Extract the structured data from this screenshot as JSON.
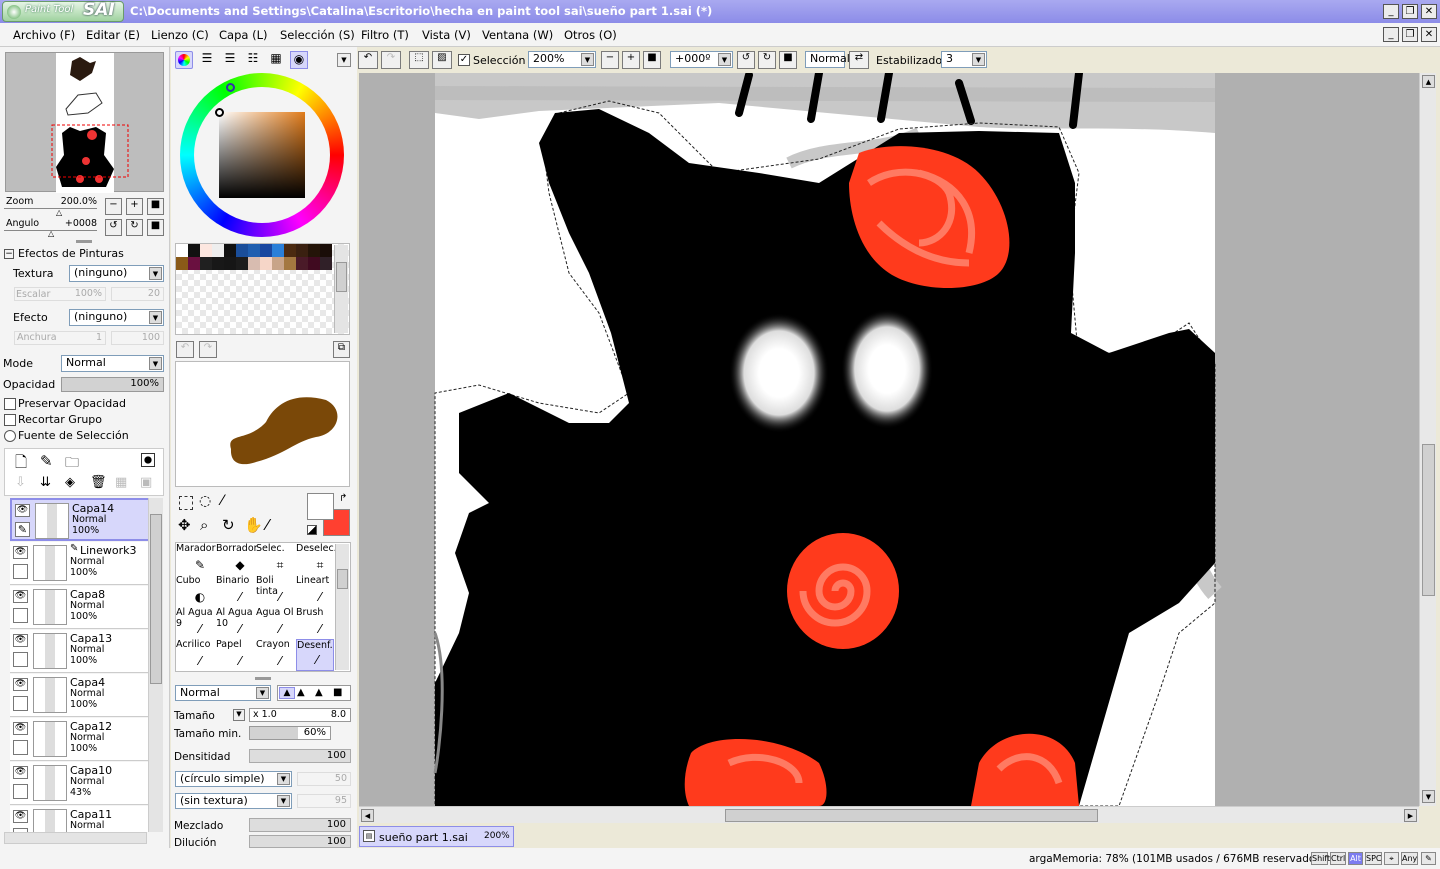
{
  "app": {
    "title": "C:\\Documents and Settings\\Catalina\\Escritorio\\hecha en paint tool sai\\sueño part 1.sai (*)",
    "logo_small": "Paint Tool",
    "logo_big": "SAI"
  },
  "menu": [
    "Archivo (F)",
    "Editar (E)",
    "Lienzo (C)",
    "Capa (L)",
    "Selección (S)",
    "Filtro (T)",
    "Vista (V)",
    "Ventana (W)",
    "Otros (O)"
  ],
  "toolbar": {
    "selection_label": "Selección",
    "zoom": "200%",
    "angle": "+000º",
    "blend": "Normal",
    "stabilizer_label": "Estabilizador",
    "stabilizer": "3"
  },
  "navigator": {
    "zoom_label": "Zoom",
    "zoom_value": "200.0%",
    "angle_label": "Angulo",
    "angle_value": "+0008"
  },
  "effects": {
    "title": "Efectos de Pinturas",
    "texture_label": "Textura",
    "texture_value": "(ninguno)",
    "scale_label": "Escalar",
    "scale_value": "100%",
    "scale_num": "20",
    "effect_label": "Efecto",
    "effect_value": "(ninguno)",
    "width_label": "Anchura",
    "width_value": "1",
    "width_num": "100"
  },
  "layer_props": {
    "mode_label": "Mode",
    "mode_value": "Normal",
    "opacity_label": "Opacidad",
    "opacity_value": "100%",
    "opacity_level": 1.0,
    "preserve": "Preservar Opacidad",
    "clip": "Recortar Grupo",
    "source": "Fuente de Selección"
  },
  "layers": [
    {
      "name": "Capa14",
      "mode": "Normal",
      "opacity": "100%",
      "selected": true
    },
    {
      "name": "Linework3",
      "mode": "Normal",
      "opacity": "100%",
      "selected": false
    },
    {
      "name": "Capa8",
      "mode": "Normal",
      "opacity": "100%",
      "selected": false
    },
    {
      "name": "Capa13",
      "mode": "Normal",
      "opacity": "100%",
      "selected": false
    },
    {
      "name": "Capa4",
      "mode": "Normal",
      "opacity": "100%",
      "selected": false
    },
    {
      "name": "Capa12",
      "mode": "Normal",
      "opacity": "100%",
      "selected": false
    },
    {
      "name": "Capa10",
      "mode": "Normal",
      "opacity": "43%",
      "selected": false
    },
    {
      "name": "Capa11",
      "mode": "Normal",
      "opacity": "",
      "selected": false
    }
  ],
  "tools": [
    {
      "name": "Marador",
      "sub": ""
    },
    {
      "name": "Borrador",
      "sub": ""
    },
    {
      "name": "Selec.",
      "sub": ""
    },
    {
      "name": "Deselec.",
      "sub": ""
    },
    {
      "name": "Cubo",
      "sub": ""
    },
    {
      "name": "Binario",
      "sub": ""
    },
    {
      "name": "Boli tinta",
      "sub": ""
    },
    {
      "name": "Lineart",
      "sub": ""
    },
    {
      "name": "Al Agua",
      "sub": "9"
    },
    {
      "name": "Al Agua",
      "sub": "10"
    },
    {
      "name": "Agua Ol",
      "sub": ""
    },
    {
      "name": "Brush",
      "sub": ""
    },
    {
      "name": "Acrilico",
      "sub": ""
    },
    {
      "name": "Papel",
      "sub": ""
    },
    {
      "name": "Crayon",
      "sub": ""
    },
    {
      "name": "Desenf.",
      "sub": ""
    }
  ],
  "brush": {
    "mode": "Normal",
    "size_label": "Tamaño",
    "size_mult": "x 1.0",
    "size_value": "8.0",
    "minsize_label": "Tamaño min.",
    "minsize_value": "60%",
    "minsize_level": 0.6,
    "density_label": "Densitidad",
    "density_value": "100",
    "shape": "(círculo simple)",
    "shape_num": "50",
    "texture": "(sin textura)",
    "texture_num": "95",
    "blend_label": "Mezclado",
    "blend_value": "100",
    "dilution_label": "Dilución",
    "dilution_value": "100"
  },
  "colors": {
    "primary": "#ffffff",
    "secondary": "#ff4030",
    "accent": "#b5b5f5",
    "rose": "#ff3a1c"
  },
  "doc_tab": {
    "name": "sueño part 1.sai",
    "zoom": "200%"
  },
  "status": {
    "memory": "argaMemoria: 78% (101MB usados / 676MB reservados)",
    "keys": [
      "Shift",
      "Ctrl",
      "Alt",
      "SPC",
      "⌖",
      "Any",
      "✎"
    ]
  }
}
